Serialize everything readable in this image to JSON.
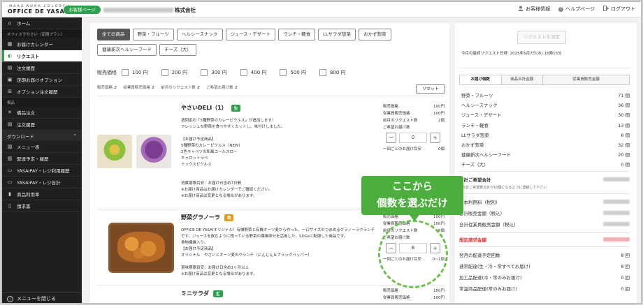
{
  "header": {
    "logo_top": "ＭＡＫＥ ＷＯＲＫ ＣＯＬＯＲＦＵＬ",
    "logo_main": "OFFICE DE YASAI",
    "customer_page": "お客様ページ",
    "company_suffix": "株式会社",
    "nav": [
      {
        "icon": "user-icon",
        "label": "お客様情報"
      },
      {
        "icon": "help-icon",
        "label": "ヘルプページ"
      },
      {
        "icon": "logout-icon",
        "label": "ログアウト"
      }
    ]
  },
  "sidebar": {
    "home": "ホーム",
    "section1": "オフィスでやさい（定期プラン）",
    "items1": [
      {
        "icon": "calendar-icon",
        "label": "お届けカレンダー"
      },
      {
        "icon": "cart-icon",
        "label": "リクエスト"
      },
      {
        "icon": "history-icon",
        "label": "注文履歴"
      },
      {
        "icon": "box-icon",
        "label": "定期お届けオプション"
      },
      {
        "icon": "option-history-icon",
        "label": "オプション注文履歴"
      }
    ],
    "section2": "備品",
    "items2": [
      {
        "icon": "tools-icon",
        "label": "備品注文"
      },
      {
        "icon": "history-icon",
        "label": "注文履歴"
      }
    ],
    "download_label": "ダウンロード",
    "items3": [
      {
        "icon": "menu-icon",
        "label": "メニュー表"
      },
      {
        "icon": "delivery-icon",
        "label": "配達予定・履歴"
      },
      {
        "icon": "card-icon",
        "label": "YASAIPAY・レジ利用履歴"
      },
      {
        "icon": "card-icon",
        "label": "YASAIPAY・レジ合計"
      },
      {
        "icon": "chart-icon",
        "label": "商品利用率"
      },
      {
        "icon": "invoice-icon",
        "label": "請求書"
      }
    ],
    "close_menu": "メニューを閉じる"
  },
  "categories": [
    "全ての商品",
    "野菜・フルーツ",
    "ヘルシースナック",
    "ジュース・デザート",
    "ランチ・軽食",
    "LLサラダ惣菜",
    "おかず惣菜",
    "健康新次ヘルシーフード",
    "チーズ（大）"
  ],
  "price_filter": {
    "title": "販売価格",
    "options": [
      "100 円",
      "200 円",
      "300 円",
      "400 円",
      "500 円",
      "800 円"
    ]
  },
  "sort_links": [
    "販売価格 ⇵",
    "従業員販売価格 ⇵",
    "前月のリクエスト数 ⇵",
    "ご希望お届け数 ⇵"
  ],
  "reset": "リセット",
  "products": [
    {
      "name": "やさいDELI（1）",
      "tag": "生",
      "tag_color": "#2e9e4f",
      "desc": "週回定の「5種野菜のカレーピクルス」が追加します！\nフレッシュな野菜を食べやすくカットし、味付けしました。\n\n【お届け予定商品】\n5種野菜のカレーピクルス（NEW）\n2色キャベツの和風コールスロー\nキャロットラペ\nミックスピクルス\n\n\n消費期限目安：お届け日含め7日間\n※お届け商品はお届けカレンダーでご確認ください。\n※お届け商品は変更となる場合があります。",
      "stats": [
        [
          "販売価格",
          "100円"
        ],
        [
          "従業員販売価格",
          "100円"
        ],
        [
          "前月のリクエスト数",
          "2個"
        ],
        [
          "ご希望お届け数",
          ""
        ]
      ],
      "qty": "0",
      "per": [
        "一回ごとのお届け目安",
        "0個"
      ]
    },
    {
      "name": "野菜グラノーラ",
      "tag": "常",
      "tag_color": "#e39b1f",
      "desc": "OFFICE DE YASAIオリジナル！有機野菜と有機オーツ麦から作った、一口サイズのつまめるグラノーラクランチです。ジュースを飲むように残っている野菜の繊維部分を活用した、SDGsに配慮した商品です。\n食物繊維入り。\n【お届け予定商品】\nオリジナル　やさいとオーツ麦のクランチ（にんじん＆ブラックペッパー）\n\n賞味期限目安：お届け日含め1ヶ月以上\n※お届け商品は変更となる場合があります。",
      "stats": [
        [
          "販売価格",
          "100円"
        ],
        [
          "従業員販売価格",
          "100円"
        ],
        [
          "前月のリクエスト数",
          "6個"
        ],
        [
          "ご希望お届け数",
          ""
        ]
      ],
      "qty": "6",
      "per": [
        "一回ごとのお届け目安",
        "0~1個"
      ]
    },
    {
      "name": "ミニサラダ",
      "tag": "生",
      "tag_color": "#2e9e4f",
      "stats": [
        [
          "販売価格",
          "100円"
        ],
        [
          "従業員販売価格",
          "100円"
        ]
      ]
    }
  ],
  "callout": {
    "line1": "ここから",
    "line2": "個数を選ぶだけ"
  },
  "right": {
    "request_button": "リクエストを決定",
    "deadline": "今月の最終リクエスト日時: 2025年5月7日(水) 16時15分",
    "tabs": [
      "お届け個数",
      "商品合計金額",
      "従業員販売金額"
    ],
    "counts": [
      [
        "野菜・フルーツ",
        "71 個"
      ],
      [
        "ヘルシースナック",
        "36 個"
      ],
      [
        "ジュース・デザート",
        "30 個"
      ],
      [
        "ランチ・軽食",
        "13 個"
      ],
      [
        "LLサラダ惣菜",
        "8 個"
      ],
      [
        "おかず惣菜",
        "32 個"
      ],
      [
        "健康新次ヘルシーフード",
        "20 個"
      ],
      [
        "チーズ（大）",
        "0 個"
      ]
    ],
    "total_label": "合計ご希望合計",
    "total_note": "※合計ご希望数合計が10個になるように登録して下さい",
    "fees": [
      "基本利用料（税別）",
      "合計販売金額（税込）",
      "合計従業員販売金額（税込）"
    ],
    "estimate_label": "想定請求金額",
    "schedule": [
      [
        "翌月の配達予定回数",
        "8 回"
      ],
      [
        "通常配達(生・冷・常すべてお届け)",
        "8 回"
      ],
      [
        "加工品配達(冷・常のみお届け)",
        "0 回"
      ],
      [
        "常温商品配達(常のみお届け)",
        "0 回"
      ]
    ]
  }
}
